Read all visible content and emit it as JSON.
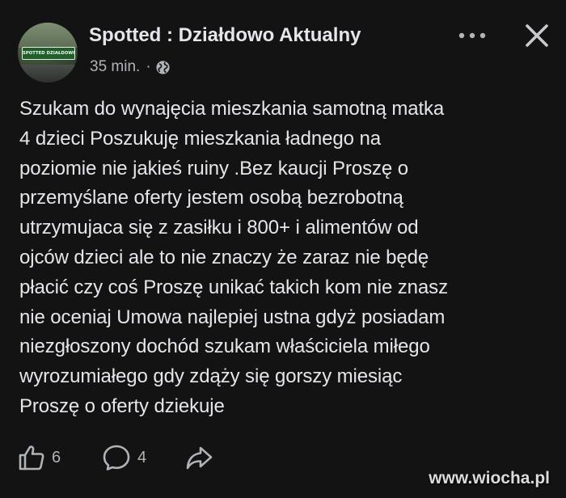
{
  "post": {
    "author": {
      "name": "Spotted : Działdowo Aktualny",
      "avatar_sign_text": "SPOTTED DZIAŁDOWO"
    },
    "timestamp": "35 min.",
    "separator": "·",
    "audience_icon": "globe-icon",
    "menu_icon": "more-horizontal-icon",
    "close_icon": "close-icon",
    "text_lines": [
      "Szukam do wynajęcia mieszkania samotną matka",
      "4 dzieci Poszukuję mieszkania ładnego na",
      "poziomie nie jakieś ruiny .Bez kaucji Proszę o",
      "przemyślane oferty jestem osobą bezrobotną",
      "utrzymujaca się z zasiłku i 800+ i alimentów od",
      "ojców dzieci ale to nie znaczy że zaraz nie będę",
      "płacić czy coś Proszę unikać takich kom nie znasz",
      "nie oceniaj Umowa najlepiej ustna gdyż posiadam",
      "niezgłoszony dochód szukam właściciela miłego",
      "wyrozumiałego gdy zdąży się gorszy miesiąc",
      "Proszę o oferty dziekuje"
    ],
    "actions": {
      "like": {
        "icon": "thumbs-up-icon",
        "count": "6"
      },
      "comment": {
        "icon": "comment-icon",
        "count": "4"
      },
      "share": {
        "icon": "share-icon"
      }
    }
  },
  "watermark": "www.wiocha.pl",
  "colors": {
    "background": "#131313",
    "text_primary": "#e4e6eb",
    "text_secondary": "#b0b3b8"
  }
}
